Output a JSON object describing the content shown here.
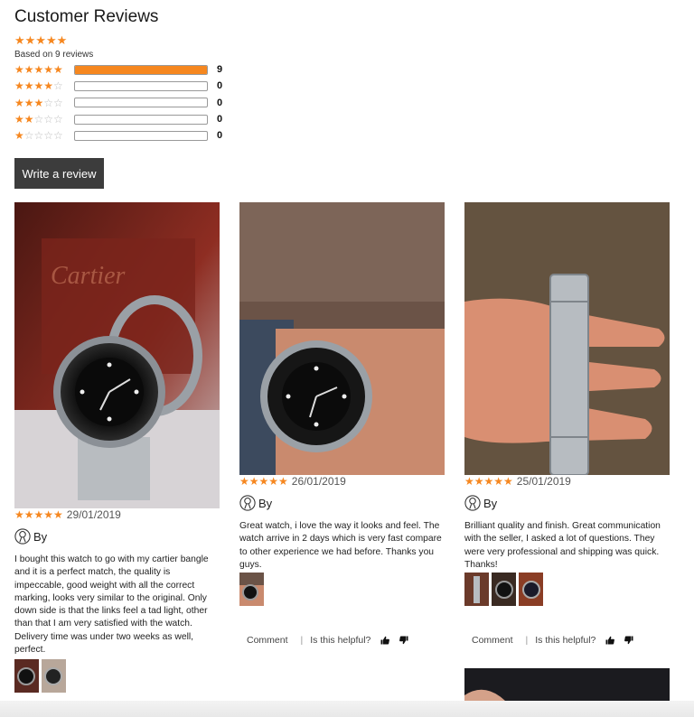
{
  "header": {
    "title": "Customer Reviews",
    "based_on": "Based on 9 reviews",
    "average_stars": "★★★★★"
  },
  "histogram": [
    {
      "stars_on": "★★★★★",
      "stars_off": "",
      "count": "9",
      "fraction": 1.0
    },
    {
      "stars_on": "★★★★",
      "stars_off": "☆",
      "count": "0",
      "fraction": 0
    },
    {
      "stars_on": "★★★",
      "stars_off": "☆☆",
      "count": "0",
      "fraction": 0
    },
    {
      "stars_on": "★★",
      "stars_off": "☆☆☆",
      "count": "0",
      "fraction": 0
    },
    {
      "stars_on": "★",
      "stars_off": "☆☆☆☆",
      "count": "0",
      "fraction": 0
    }
  ],
  "write_review_label": "Write a review",
  "reviews": [
    {
      "stars": "★★★★★",
      "date": "29/01/2019",
      "author": "By",
      "text": "I bought this watch to go with my cartier bangle and it is a perfect match, the quality is impeccable, good weight with all the correct marking, looks very similar to the original. Only down side is that the links feel a tad light, other than that I am very satisfied with the watch. Delivery time was under two weeks as well, perfect.",
      "box_label": "Cartier"
    },
    {
      "stars": "★★★★★",
      "date": "26/01/2019",
      "author": "By",
      "text": "Great watch, i love the way it looks and feel. The watch arrive in 2 days which is very fast compare to other experience we had before. Thanks you guys.",
      "comment_label": "Comment",
      "helpful_label": "Is this helpful?"
    },
    {
      "stars": "★★★★★",
      "date": "25/01/2019",
      "author": "By",
      "text": "Brilliant quality and finish. Great communication with the seller, I asked a lot of questions. They were very professional and shipping was quick. Thanks!",
      "comment_label": "Comment",
      "helpful_label": "Is this helpful?"
    }
  ],
  "separator": "|",
  "colors": {
    "accent": "#f6871f",
    "button_bg": "#3c3c3c"
  },
  "icons": [
    "user-outline-icon",
    "thumbs-up-icon",
    "thumbs-down-icon"
  ]
}
